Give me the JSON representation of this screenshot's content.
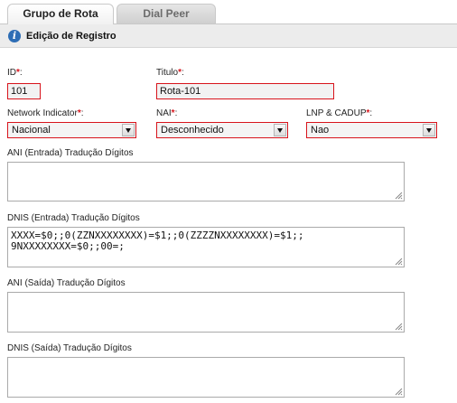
{
  "tabs": [
    {
      "label": "Grupo de Rota",
      "active": true
    },
    {
      "label": "Dial Peer",
      "active": false
    }
  ],
  "toolbar": {
    "icon": "info-icon",
    "title": "Edição de Registro"
  },
  "form": {
    "required_mark": "*",
    "id": {
      "label": "ID",
      "value": "101"
    },
    "titulo": {
      "label": "Titulo",
      "value": "Rota-101"
    },
    "network_indicator": {
      "label": "Network Indicator",
      "value": "Nacional"
    },
    "nai": {
      "label": "NAI",
      "value": "Desconhecido"
    },
    "lnp_cadup": {
      "label": "LNP & CADUP",
      "value": "Nao"
    },
    "ani_entrada": {
      "label": "ANI (Entrada) Tradução Dígitos",
      "value": ""
    },
    "dnis_entrada": {
      "label": "DNIS (Entrada) Tradução Dígitos",
      "line1": "XXXX=$0;;0(ZZNXXXXXXXX)=$1;;0(ZZZZNXXXXXXXX)=$1;;",
      "line2": "9NXXXXXXXX=$0;;00=;"
    },
    "ani_saida": {
      "label": "ANI (Saída) Tradução Dígitos",
      "value": ""
    },
    "dnis_saida": {
      "label": "DNIS (Saída) Tradução Dígitos",
      "value": ""
    }
  },
  "colors": {
    "required": "#d8141c",
    "info_icon": "#2d6db5",
    "toolbar_bg": "#ececec"
  }
}
